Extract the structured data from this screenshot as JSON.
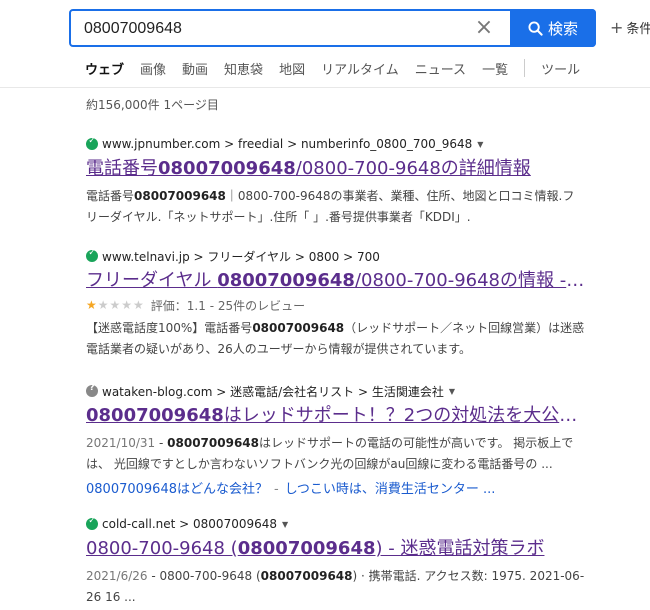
{
  "search": {
    "query": "08007009648",
    "clear_label": "×",
    "button_label": "検索",
    "conditions_label": "条件"
  },
  "tabs": [
    "ウェブ",
    "画像",
    "動画",
    "知恵袋",
    "地図",
    "リアルタイム",
    "ニュース",
    "一覧"
  ],
  "tools_label": "ツール",
  "result_count": "約156,000件 1ページ目",
  "results": [
    {
      "site": "www.jpnumber.com > freedial > numberinfo_0800_700_9648",
      "title_pre": "電話番号",
      "title_bold": "08007009648",
      "title_post": "/0800-700-9648の詳細情報",
      "snippet_pre": "電話番号",
      "snippet_bold": "08007009648",
      "snippet_post": "｜0800-700-9648の事業者、業種、住所、地図と口コミ情報.フリーダイヤル.「ネットサポート」.住所「 」.番号提供事業者「KDDI」."
    },
    {
      "site": "www.telnavi.jp > フリーダイヤル > 0800 > 700",
      "title_pre": "フリーダイヤル ",
      "title_bold": "08007009648",
      "title_post": "/0800-700-9648の情報 - 電...",
      "rating_value": 1.1,
      "rating_text": "評価：1.1 - 25件のレビュー",
      "snippet_pre": "【迷惑電話度100%】電話番号",
      "snippet_bold": "08007009648",
      "snippet_post": "（レッドサポート／ネット回線営業）は迷惑電話業者の疑いがあり、26人のユーザーから情報が提供されています。"
    },
    {
      "site": "wataken-blog.com > 迷惑電話/会社名リスト > 生活関連会社",
      "title_pre": "",
      "title_bold": "08007009648",
      "title_post": "はレッドサポート！？2つの対処法を大公開 ...",
      "date": "2021/10/31",
      "snippet_bold": "08007009648",
      "snippet_post": "はレッドサポートの電話の可能性が高いです。 掲示板上では、 光回線ですとしか言わないソフトバンク光の回線がau回線に変わる電話番号の ...",
      "sitelinks": [
        "08007009648はどんな会社？",
        "しつこい時は、消費生活センター ..."
      ]
    },
    {
      "site": "cold-call.net > 08007009648",
      "title_pre": "0800-700-9648 (",
      "title_bold": "08007009648",
      "title_post": ") - 迷惑電話対策ラボ",
      "date": "2021/6/26",
      "snippet_pre": "0800-700-9648 (",
      "snippet_bold": "08007009648",
      "snippet_post": ") · 携帯電話. アクセス数: 1975. 2021-06-26 16 ..."
    }
  ]
}
